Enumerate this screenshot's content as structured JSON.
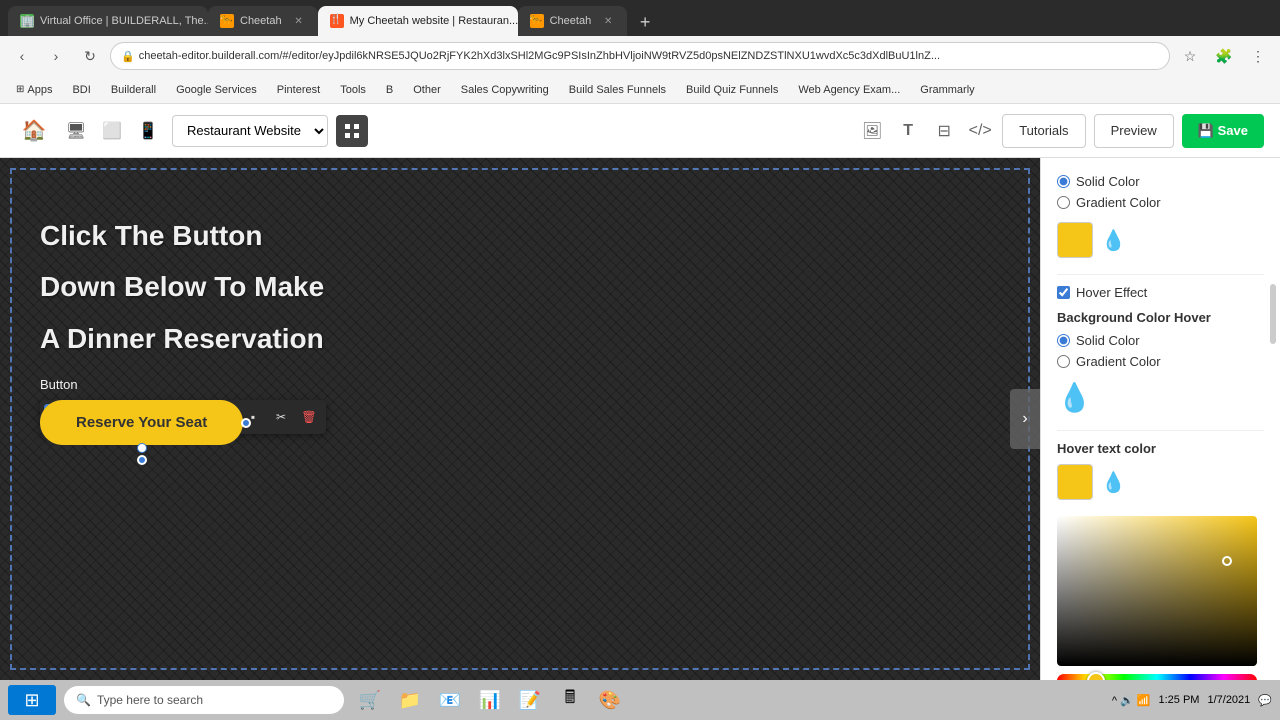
{
  "browser": {
    "tabs": [
      {
        "id": "tab1",
        "label": "Virtual Office | BUILDERALL, The...",
        "favicon": "🏢",
        "active": false
      },
      {
        "id": "tab2",
        "label": "Cheetah",
        "favicon": "🐆",
        "active": false
      },
      {
        "id": "tab3",
        "label": "My Cheetah website | Restauran...",
        "favicon": "🍴",
        "active": true
      },
      {
        "id": "tab4",
        "label": "Cheetah",
        "favicon": "🐆",
        "active": false
      }
    ],
    "address": "cheetah-editor.builderall.com/#/editor/eyJpdil6kNRSE5JQUo2RjFYK2hXd3lxSHl2MGc9PSIsInZhbHVljoiNW9tRVZ5d0psNElZNDZSTlNXU1wvdXc5c3dXdlBuU1lnZ..."
  },
  "bookmarks": [
    {
      "label": "Apps"
    },
    {
      "label": "BDI"
    },
    {
      "label": "Builderall"
    },
    {
      "label": "Google Services"
    },
    {
      "label": "Pinterest"
    },
    {
      "label": "Tools"
    },
    {
      "label": "B"
    },
    {
      "label": "Other"
    },
    {
      "label": "Sales Copywriting"
    },
    {
      "label": "Build Sales Funnels"
    },
    {
      "label": "Build Quiz Funnels"
    },
    {
      "label": "Web Agency Exam..."
    },
    {
      "label": "Grammarly"
    }
  ],
  "editor": {
    "device_label": "Restaurant Website",
    "buttons": {
      "tutorials": "Tutorials",
      "preview": "Preview",
      "save": "Save"
    }
  },
  "canvas": {
    "text_line1": "Click The Button",
    "text_line2": "Down Below To Make",
    "text_line3": "A Dinner Reservation",
    "button_label": "Reserve Your Seat",
    "button_sublabel": "Button"
  },
  "floating_toolbar": {
    "tools": [
      {
        "icon": "⊞",
        "name": "grid-tool"
      },
      {
        "icon": "✏️",
        "name": "edit-tool"
      },
      {
        "icon": "☁",
        "name": "style-tool"
      },
      {
        "icon": "≋",
        "name": "filter-tool"
      },
      {
        "icon": "≡",
        "name": "align-tool"
      },
      {
        "icon": "🔗",
        "name": "link-tool"
      },
      {
        "icon": "⚙",
        "name": "settings-tool"
      },
      {
        "icon": "▪",
        "name": "box-tool"
      },
      {
        "icon": "✂",
        "name": "cut-tool"
      },
      {
        "icon": "🗑",
        "name": "delete-tool"
      }
    ]
  },
  "right_panel": {
    "section_bg_color": {
      "title": "",
      "solid_color_label": "Solid Color",
      "gradient_color_label": "Gradient Color",
      "solid_selected": true,
      "colors": {
        "swatch1": "yellow",
        "swatch2": "dark"
      }
    },
    "hover_effect": {
      "label": "Hover Effect",
      "checked": true
    },
    "section_hover_bg": {
      "title": "Background Color Hover",
      "solid_color_label": "Solid Color",
      "gradient_color_label": "Gradient Color",
      "solid_selected": true
    },
    "section_hover_text": {
      "title": "Hover text color",
      "colors": {
        "swatch1": "yellow",
        "swatch2": "dark"
      }
    }
  },
  "taskbar": {
    "search_placeholder": "Type here to search",
    "time": "1:25 PM",
    "date": "1/7/2021"
  }
}
